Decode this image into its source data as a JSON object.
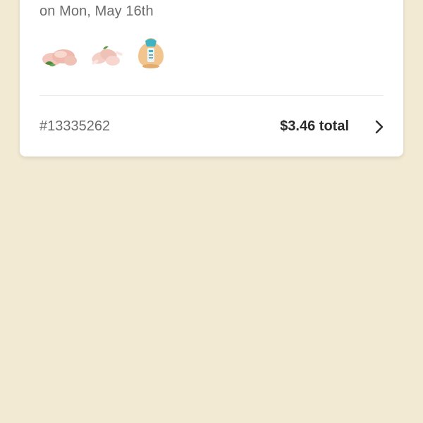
{
  "order": {
    "date_text": "on Mon, May 16th",
    "items": [
      {
        "icon": "raw-chicken-pieces-image"
      },
      {
        "icon": "raw-chicken-drumsticks-image"
      },
      {
        "icon": "packaged-whole-chicken-image"
      }
    ],
    "number": "#13335262",
    "total": "$3.46 total",
    "chevron_icon": "chevron-right-icon"
  },
  "colors": {
    "background": "#f2ead3",
    "card": "#ffffff",
    "muted_text": "#6b6b6b",
    "strong_text": "#2b2b2b"
  }
}
